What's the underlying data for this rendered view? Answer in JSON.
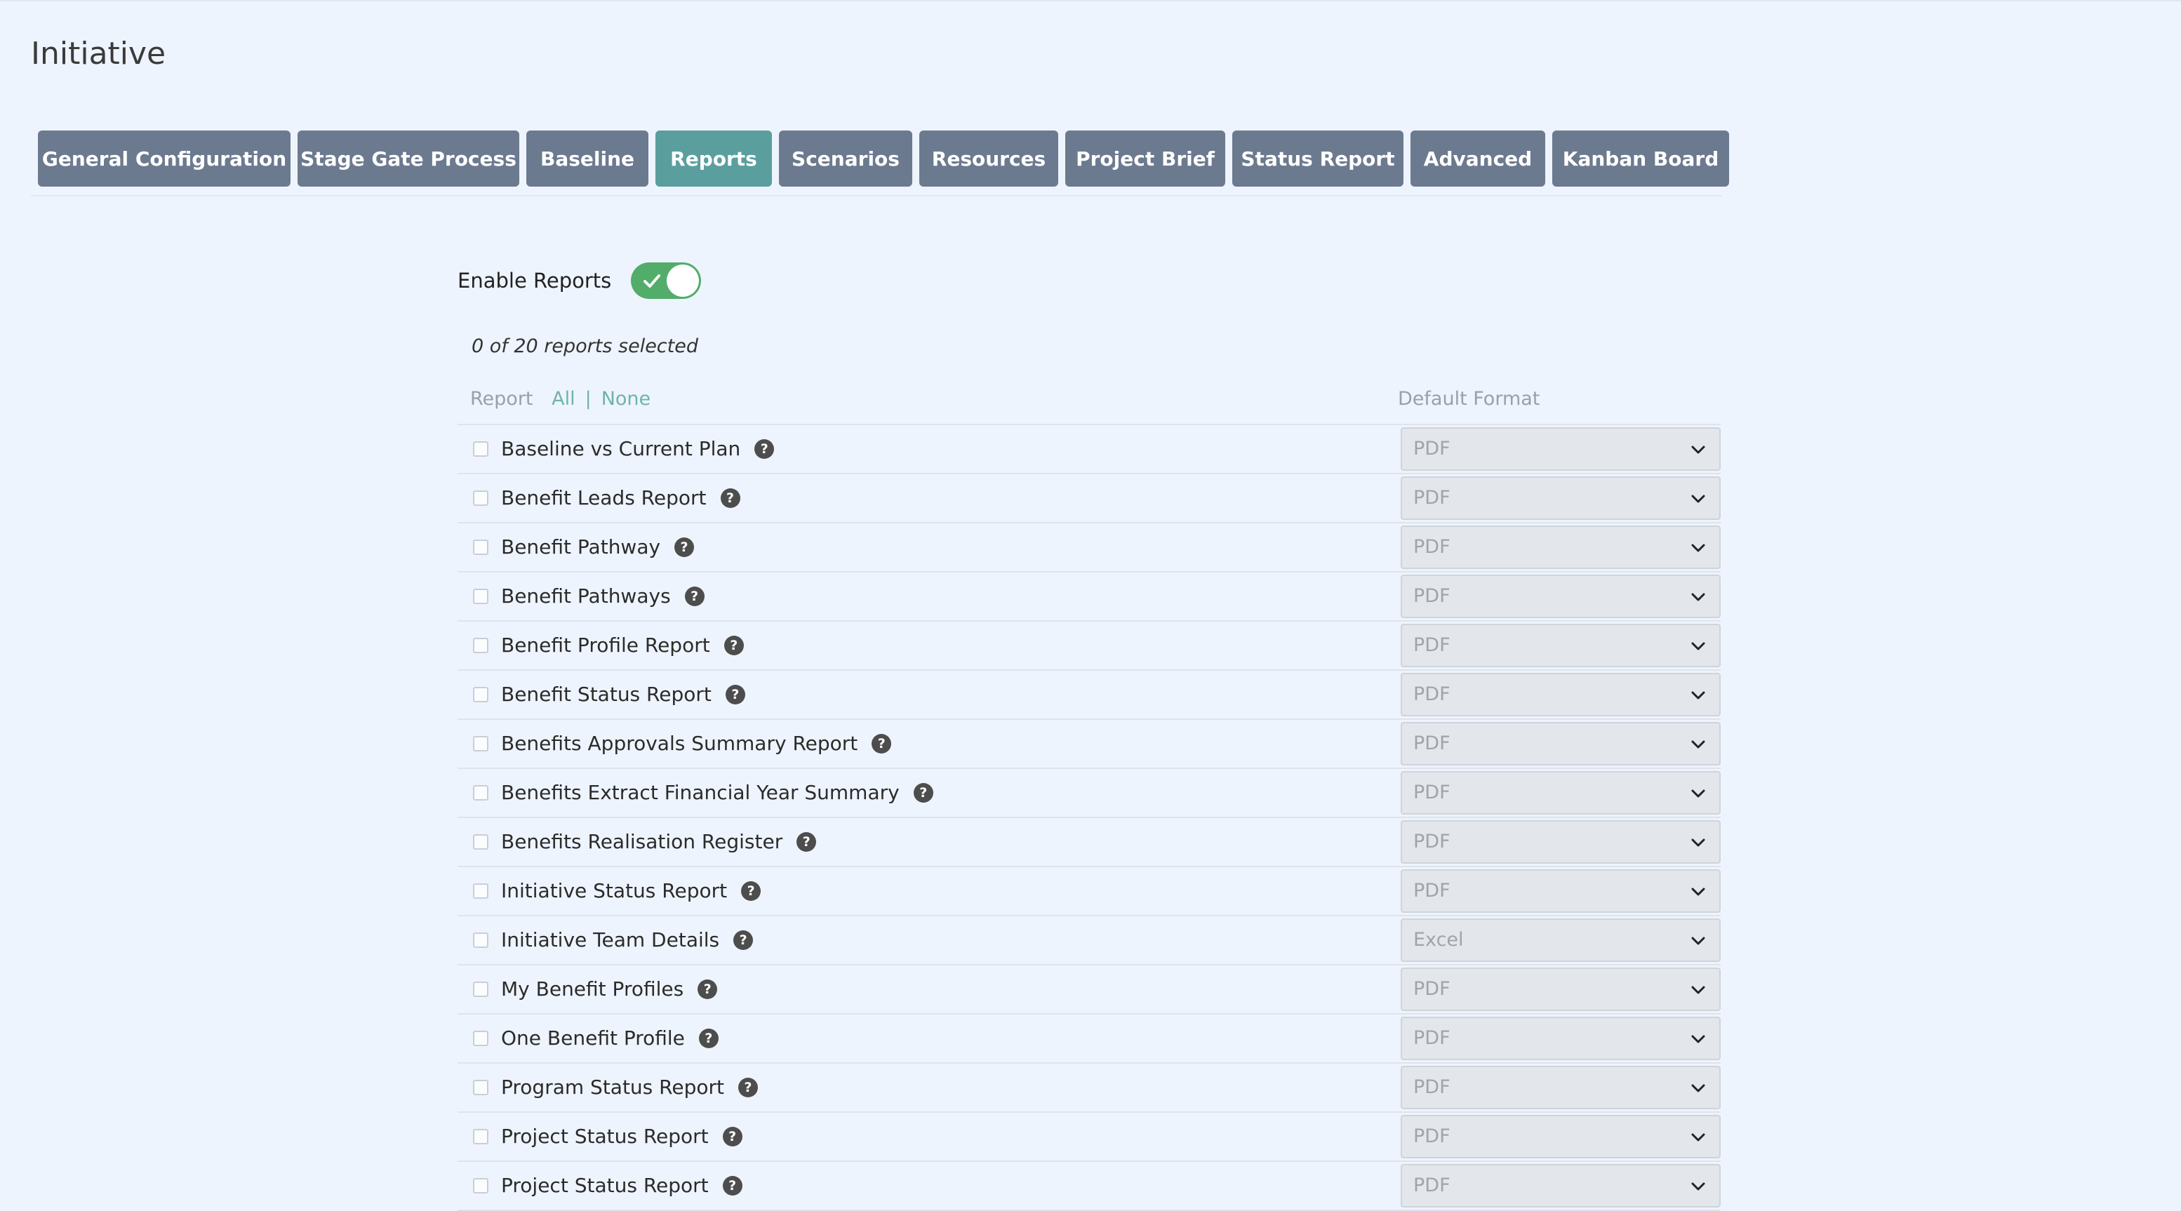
{
  "page": {
    "title": "Initiative"
  },
  "tabs": [
    {
      "label": "General Configuration",
      "active": false
    },
    {
      "label": "Stage Gate Process",
      "active": false
    },
    {
      "label": "Baseline",
      "active": false
    },
    {
      "label": "Reports",
      "active": true
    },
    {
      "label": "Scenarios",
      "active": false
    },
    {
      "label": "Resources",
      "active": false
    },
    {
      "label": "Project Brief",
      "active": false
    },
    {
      "label": "Status Report",
      "active": false
    },
    {
      "label": "Advanced",
      "active": false
    },
    {
      "label": "Kanban Board",
      "active": false
    }
  ],
  "reports_settings": {
    "enable_label": "Enable Reports",
    "enabled": true,
    "selected_summary": "0 of 20 reports selected"
  },
  "table": {
    "report_header": "Report",
    "all_link": "All",
    "separator": "|",
    "none_link": "None",
    "format_header": "Default Format",
    "rows": [
      {
        "name": "Baseline vs Current Plan",
        "format": "PDF",
        "checked": false
      },
      {
        "name": "Benefit Leads Report",
        "format": "PDF",
        "checked": false
      },
      {
        "name": "Benefit Pathway",
        "format": "PDF",
        "checked": false
      },
      {
        "name": "Benefit Pathways",
        "format": "PDF",
        "checked": false
      },
      {
        "name": "Benefit Profile Report",
        "format": "PDF",
        "checked": false
      },
      {
        "name": "Benefit Status Report",
        "format": "PDF",
        "checked": false
      },
      {
        "name": "Benefits Approvals Summary Report",
        "format": "PDF",
        "checked": false
      },
      {
        "name": "Benefits Extract Financial Year Summary",
        "format": "PDF",
        "checked": false
      },
      {
        "name": "Benefits Realisation Register",
        "format": "PDF",
        "checked": false
      },
      {
        "name": "Initiative Status Report",
        "format": "PDF",
        "checked": false
      },
      {
        "name": "Initiative Team Details",
        "format": "Excel",
        "checked": false
      },
      {
        "name": "My Benefit Profiles",
        "format": "PDF",
        "checked": false
      },
      {
        "name": "One Benefit Profile",
        "format": "PDF",
        "checked": false
      },
      {
        "name": "Program Status Report",
        "format": "PDF",
        "checked": false
      },
      {
        "name": "Project Status Report",
        "format": "PDF",
        "checked": false
      },
      {
        "name": "Project Status Report",
        "format": "PDF",
        "checked": false
      }
    ]
  },
  "icons": {
    "help": "help-circle-icon",
    "dropdown": "chevron-down-icon",
    "toggle_on": "check-icon"
  },
  "colors": {
    "background": "#eef4fd",
    "tab": "#6c7a8f",
    "tab_active": "#5a9f9d",
    "toggle_on": "#52ad6a",
    "link": "#6fb3ad"
  }
}
